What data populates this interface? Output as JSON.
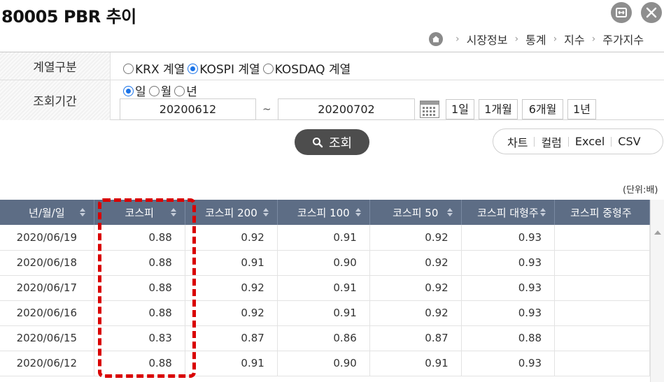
{
  "page": {
    "title": "80005 PBR 추이"
  },
  "window": {
    "expand_icon": "expand-icon",
    "close_icon": "close-icon"
  },
  "breadcrumb": {
    "home_icon": "home-icon",
    "items": [
      "시장정보",
      "통계",
      "지수",
      "주가지수"
    ]
  },
  "filters": {
    "series_label": "계열구분",
    "series_options": [
      {
        "label": "KRX 계열",
        "selected": false
      },
      {
        "label": "KOSPI 계열",
        "selected": true
      },
      {
        "label": "KOSDAQ 계열",
        "selected": false
      }
    ],
    "period_label": "조회기간",
    "period_options": [
      {
        "label": "일",
        "selected": true
      },
      {
        "label": "월",
        "selected": false
      },
      {
        "label": "년",
        "selected": false
      }
    ],
    "start_date": "20200612",
    "range_sep": "~",
    "end_date": "20200702",
    "calendar_icon": "calendar-icon",
    "quick_ranges": [
      "1일",
      "1개월",
      "6개월",
      "1년"
    ]
  },
  "search": {
    "label": "조회",
    "icon": "search-icon"
  },
  "tools": {
    "chart": "차트",
    "column": "컬럼",
    "excel": "Excel",
    "csv": "CSV"
  },
  "unit": "(단위:배)",
  "table": {
    "headers": [
      "년/월/일",
      "코스피",
      "코스피 200",
      "코스피 100",
      "코스피 50",
      "코스피 대형주",
      "코스피 중형주"
    ],
    "rows": [
      [
        "2020/06/19",
        "0.88",
        "0.92",
        "0.91",
        "0.92",
        "0.93",
        ""
      ],
      [
        "2020/06/18",
        "0.88",
        "0.91",
        "0.90",
        "0.92",
        "0.93",
        ""
      ],
      [
        "2020/06/17",
        "0.88",
        "0.92",
        "0.91",
        "0.92",
        "0.93",
        ""
      ],
      [
        "2020/06/16",
        "0.88",
        "0.92",
        "0.91",
        "0.92",
        "0.93",
        ""
      ],
      [
        "2020/06/15",
        "0.83",
        "0.87",
        "0.86",
        "0.87",
        "0.88",
        ""
      ],
      [
        "2020/06/12",
        "0.88",
        "0.91",
        "0.90",
        "0.91",
        "0.93",
        ""
      ]
    ]
  },
  "colors": {
    "header_bg": "#5d6d85",
    "accent": "#1a73e8",
    "highlight": "#d90000",
    "search_bg": "#4d4d4d"
  }
}
